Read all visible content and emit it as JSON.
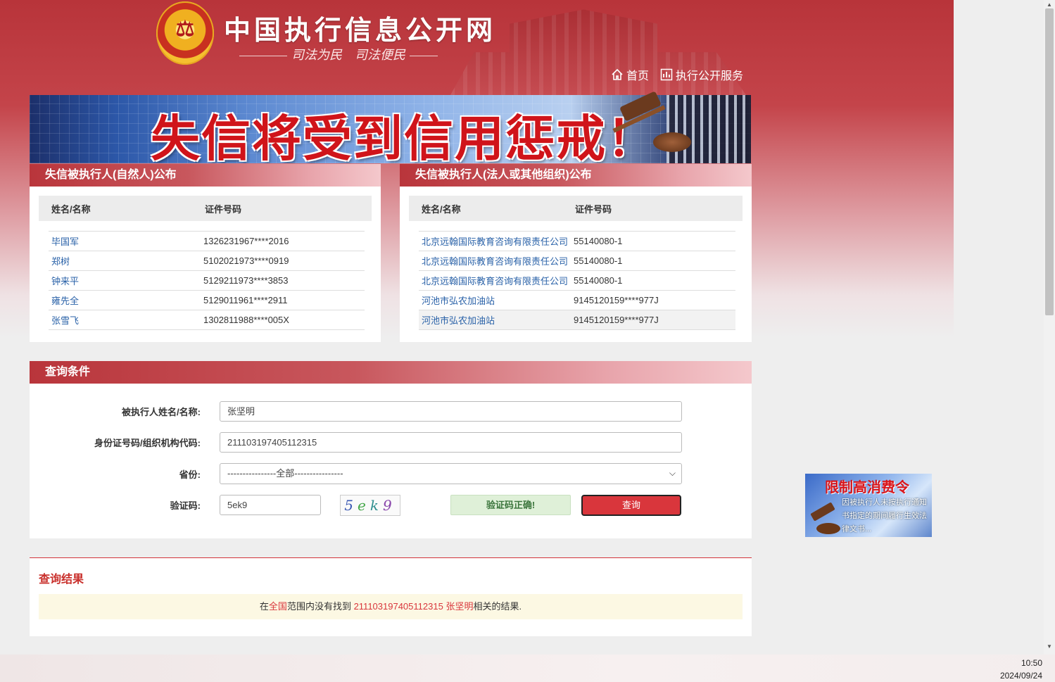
{
  "header": {
    "site_title": "中国执行信息公开网",
    "slogan": "司法为民　司法便民",
    "emblem_text": "⚖",
    "nav": [
      {
        "label": "首页",
        "icon": "home-icon"
      },
      {
        "label": "执行公开服务",
        "icon": "chart-icon"
      }
    ]
  },
  "banner": {
    "text": "失信将受到信用惩戒！"
  },
  "natural_panel": {
    "title": "失信被执行人(自然人)公布",
    "columns": [
      "姓名/名称",
      "证件号码"
    ],
    "rows": [
      {
        "name": "毕国军",
        "id": "1326231967****2016"
      },
      {
        "name": "郑树",
        "id": "5102021973****0919"
      },
      {
        "name": "钟来平",
        "id": "5129211973****3853"
      },
      {
        "name": "雍先全",
        "id": "5129011961****2911"
      },
      {
        "name": "张雪飞",
        "id": "1302811988****005X"
      }
    ]
  },
  "legal_panel": {
    "title": "失信被执行人(法人或其他组织)公布",
    "columns": [
      "姓名/名称",
      "证件号码"
    ],
    "rows": [
      {
        "name": "北京远翰国际教育咨询有限责任公司",
        "id": "55140080-1"
      },
      {
        "name": "北京远翰国际教育咨询有限责任公司",
        "id": "55140080-1"
      },
      {
        "name": "北京远翰国际教育咨询有限责任公司",
        "id": "55140080-1"
      },
      {
        "name": "河池市弘农加油站",
        "id": "9145120159****977J"
      },
      {
        "name": "河池市弘农加油站",
        "id": "9145120159****977J"
      }
    ]
  },
  "query": {
    "title": "查询条件",
    "name_label": "被执行人姓名/名称:",
    "name_value": "张坚明",
    "id_label": "身份证号码/组织机构代码:",
    "id_value": "211103197405112315",
    "province_label": "省份:",
    "province_value": "----------------全部----------------",
    "captcha_label": "验证码:",
    "captcha_value": "5ek9",
    "captcha_image": [
      "5",
      "e",
      "k",
      "9"
    ],
    "captcha_status": "验证码正确!",
    "submit_label": "查询"
  },
  "result": {
    "title": "查询结果",
    "msg_prefix": "在",
    "msg_scope": "全国",
    "msg_middle": "范围内没有找到 ",
    "msg_id": "211103197405112315",
    "msg_name": "张坚明",
    "msg_suffix": "相关的结果."
  },
  "side_ad": {
    "title": "限制高消费令",
    "text": "因被执行人未按执行通知书指定的期间履行生效法律文书..."
  },
  "taskbar": {
    "time": "10:50",
    "date": "2024/09/24"
  },
  "colors": {
    "primary_red": "#d9363c",
    "link_blue": "#2a62a8",
    "header_red": "#b9353b"
  }
}
